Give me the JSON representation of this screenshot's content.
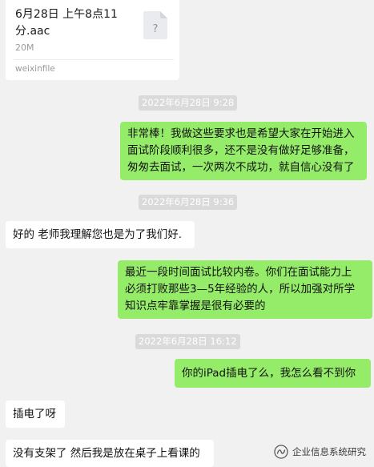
{
  "file_card": {
    "name": "6月28日 上午8点11分.aac",
    "size": "20M",
    "source": "weixinfile",
    "icon": "unknown-file-icon"
  },
  "messages": [
    {
      "type": "timestamp",
      "text": "2022年6月28日 9:28"
    },
    {
      "type": "sent",
      "lines": [
        "非常棒！我做这些要求也是希望大家在开始进入",
        "面试阶段顺利很多，还不是没有做好足够准备，",
        "匆匆去面试，一次两次不成功，就自信心没有了"
      ]
    },
    {
      "type": "timestamp",
      "text": "2022年6月28日 9:36"
    },
    {
      "type": "received",
      "lines": [
        "好的 老师我理解您也是为了我们好."
      ]
    },
    {
      "type": "sent",
      "lines": [
        "最近一段时间面试比较内卷。你们在面试能力上",
        "必须打败那些3—5年经验的人，所以加强对所学",
        "知识点牢靠掌握是很有必要的"
      ]
    },
    {
      "type": "timestamp",
      "text": "2022年6月28日 16:12"
    },
    {
      "type": "sent",
      "lines": [
        "你的iPad插电了么，我怎么看不到你"
      ]
    },
    {
      "type": "received",
      "lines": [
        "插电了呀"
      ]
    },
    {
      "type": "received",
      "lines": [
        "没有支架了 然后我是放在桌子上看课的"
      ]
    }
  ],
  "watermark": {
    "text": "企业信息系统研究",
    "icon": "wechat-channel-logo"
  },
  "colors": {
    "background": "#f1f1f1",
    "sent_bubble": "#95ec69",
    "received_bubble": "#ffffff",
    "timestamp_bg": "#dadada"
  }
}
